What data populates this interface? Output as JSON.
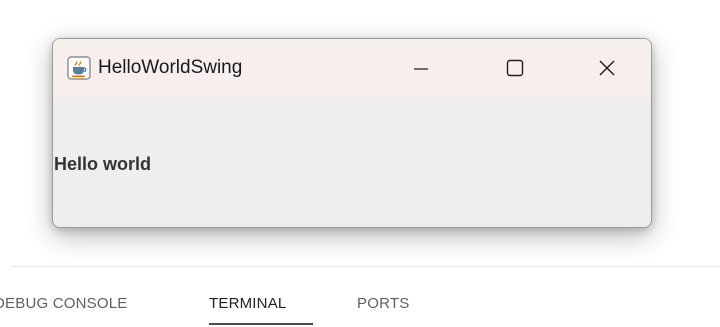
{
  "window": {
    "title": "HelloWorldSwing",
    "app_icon": "java-coffee-cup-icon",
    "controls": {
      "minimize": "minimize-icon",
      "maximize": "maximize-icon",
      "close": "close-icon"
    },
    "label": "Hello world"
  },
  "panel": {
    "tabs": [
      {
        "label": "DEBUG CONSOLE",
        "active": false
      },
      {
        "label": "TERMINAL",
        "active": true
      },
      {
        "label": "PORTS",
        "active": false
      }
    ]
  }
}
